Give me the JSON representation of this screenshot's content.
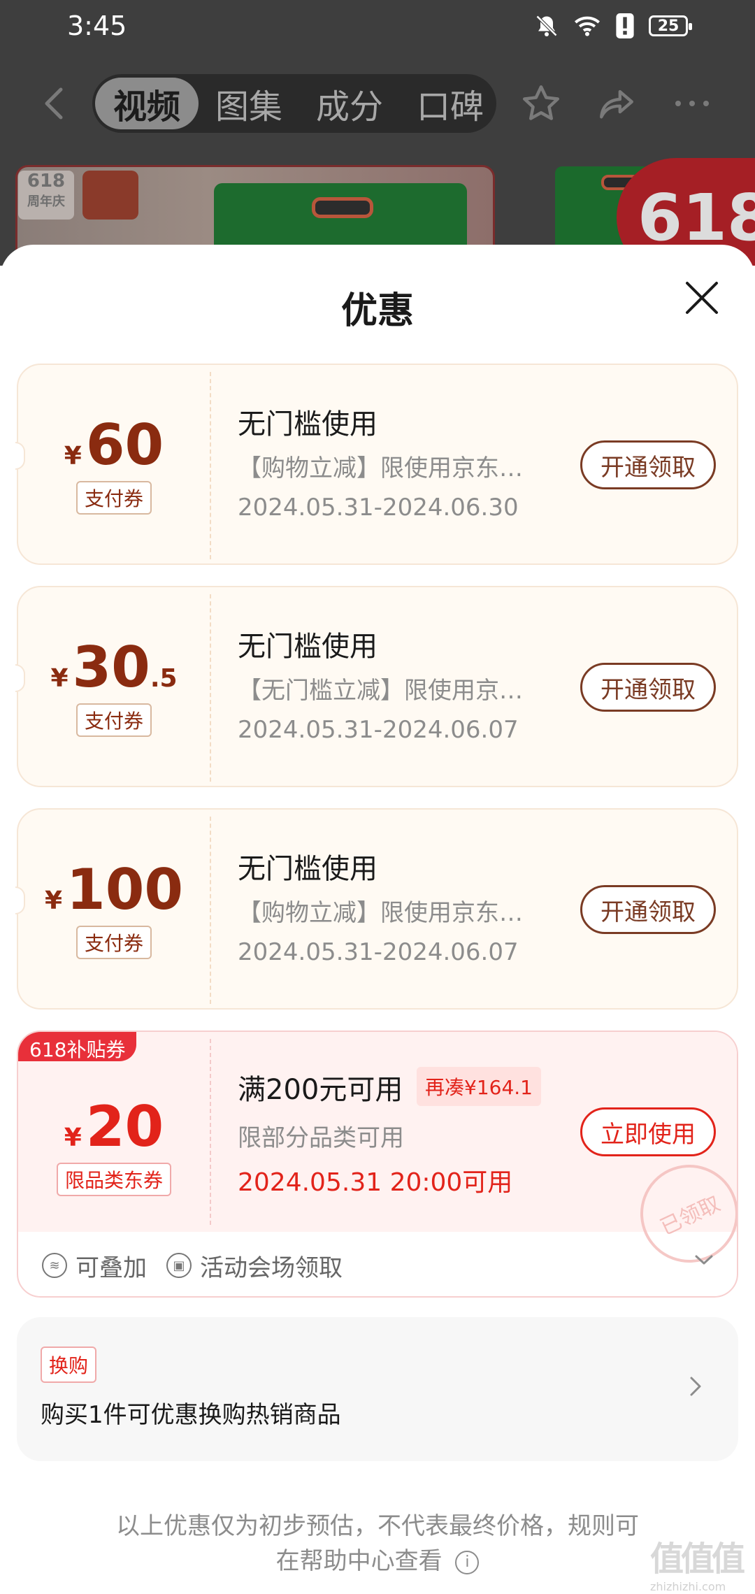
{
  "status_bar": {
    "time": "3:45",
    "battery": "25"
  },
  "nav": {
    "tabs": [
      {
        "label": "视频",
        "active": true
      },
      {
        "label": "图集",
        "active": false
      },
      {
        "label": "成分",
        "active": false
      },
      {
        "label": "口碑",
        "active": false
      }
    ]
  },
  "background_products": {
    "badge_618": "618",
    "badge_618_sub": "周年庆"
  },
  "sheet": {
    "title": "优惠",
    "coupons": [
      {
        "currency": "¥",
        "amount": "60",
        "decimal": "",
        "tag": "支付券",
        "title": "无门槛使用",
        "desc": "【购物立减】限使用京东…",
        "date": "2024.05.31-2024.06.30",
        "action": "开通领取"
      },
      {
        "currency": "¥",
        "amount": "30",
        "decimal": ".5",
        "tag": "支付券",
        "title": "无门槛使用",
        "desc": "【无门槛立减】限使用京…",
        "date": "2024.05.31-2024.06.07",
        "action": "开通领取"
      },
      {
        "currency": "¥",
        "amount": "100",
        "decimal": "",
        "tag": "支付券",
        "title": "无门槛使用",
        "desc": "【购物立减】限使用京东…",
        "date": "2024.05.31-2024.06.07",
        "action": "开通领取"
      }
    ],
    "subsidy_coupon": {
      "badge": "618补贴券",
      "currency": "¥",
      "amount": "20",
      "tag": "限品类东券",
      "title": "满200元可用",
      "extra": "再凑¥164.1",
      "desc": "限部分品类可用",
      "date": "2024.05.31 20:00可用",
      "action": "立即使用",
      "stamp": "已领取",
      "footer": {
        "stackable": "可叠加",
        "source": "活动会场领取"
      }
    },
    "exchange": {
      "tag": "换购",
      "text": "购买1件可优惠换购热销商品"
    },
    "footnote": {
      "line1": "以上优惠仅为初步预估，不代表最终价格，规则可",
      "line2": "在帮助中心查看"
    }
  },
  "watermark": {
    "glyphs": "值值值",
    "url": "zhizhizhi.com"
  },
  "colors": {
    "brown": "#7a3b24",
    "red": "#e2231a",
    "coupon_bg": "#fffaf3"
  }
}
